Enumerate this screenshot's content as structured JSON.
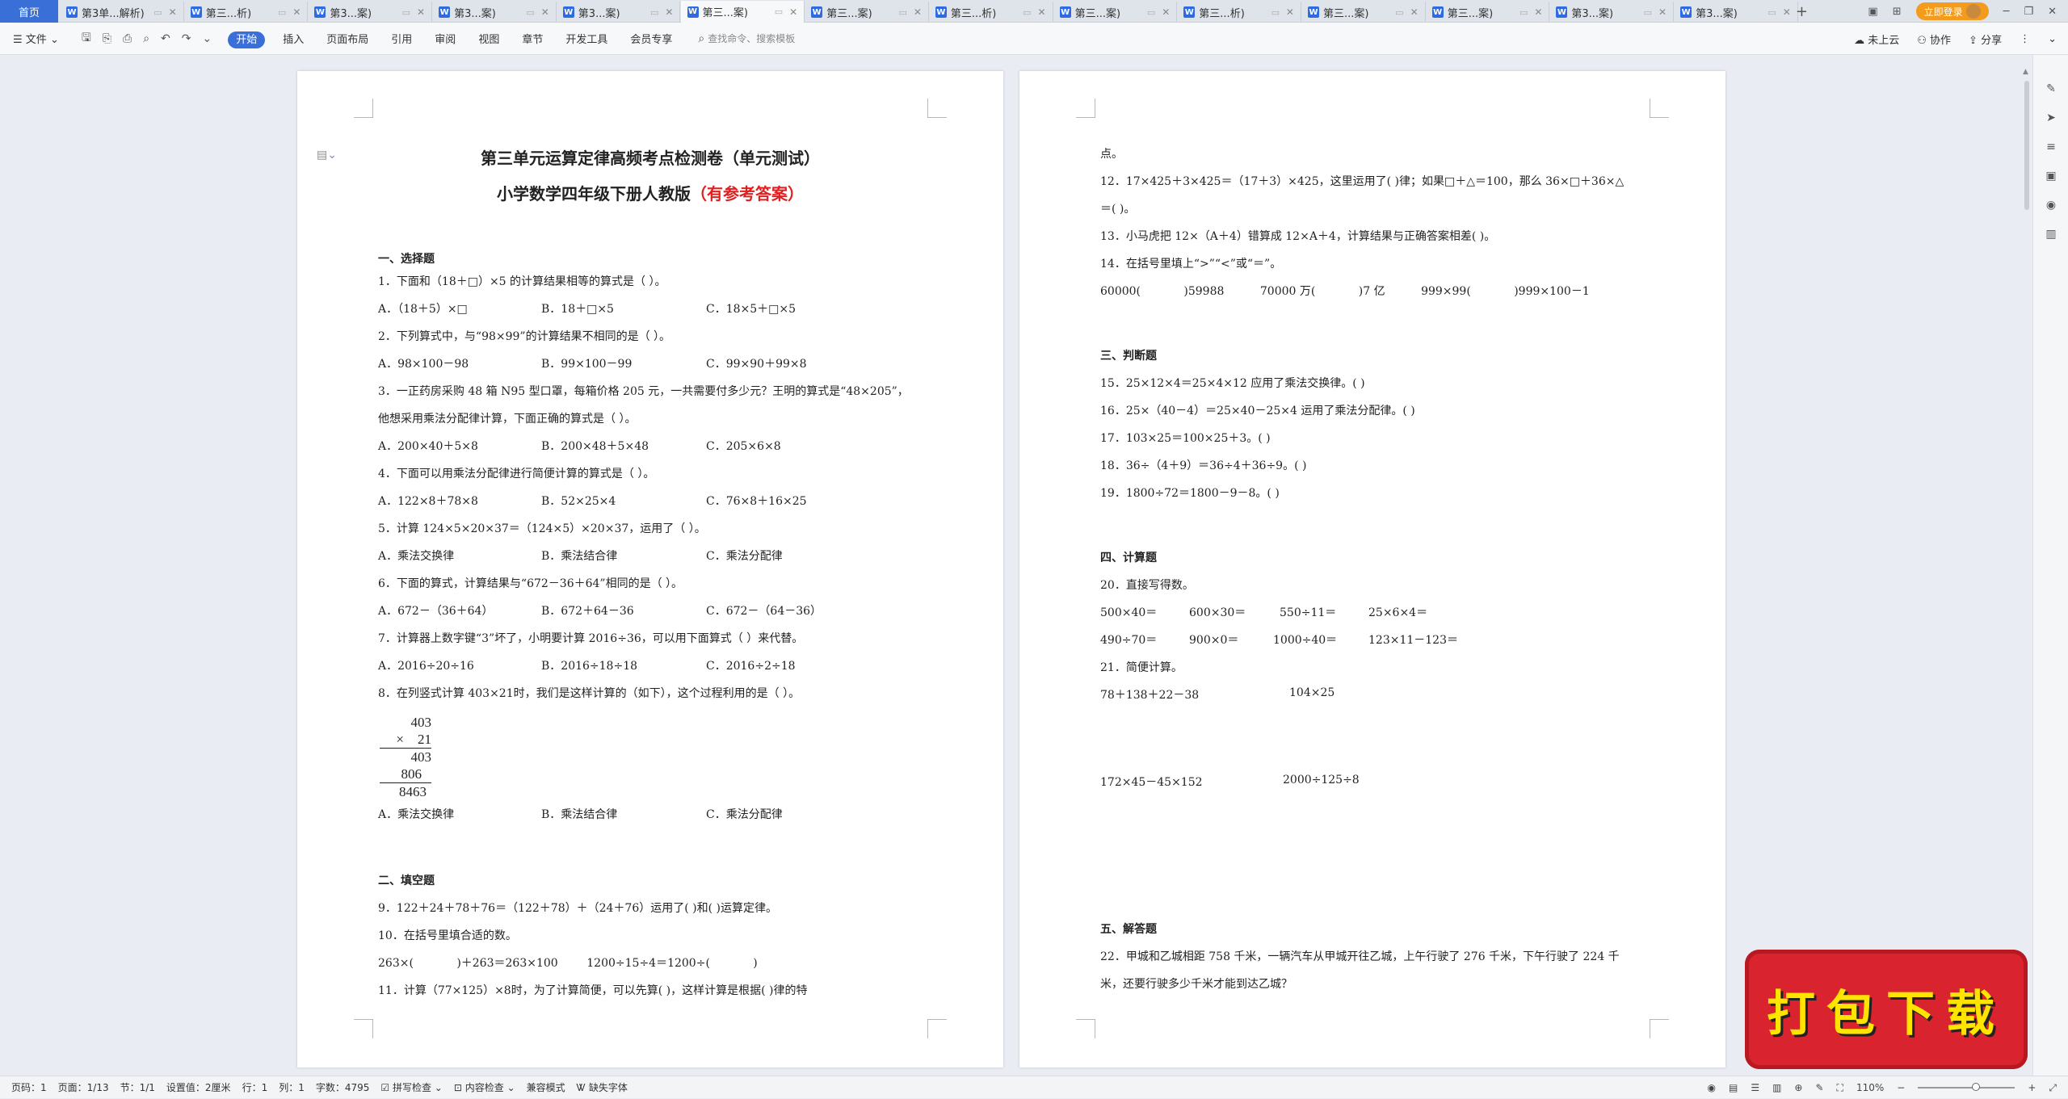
{
  "tabs": {
    "home": "首页",
    "items": [
      {
        "label": "第3单...解析)"
      },
      {
        "label": "第三...析)"
      },
      {
        "label": "第3...案)"
      },
      {
        "label": "第3...案)"
      },
      {
        "label": "第3...案)"
      },
      {
        "label": "第三...案)"
      },
      {
        "label": "第三...案)"
      },
      {
        "label": "第三...析)"
      },
      {
        "label": "第三...案)"
      },
      {
        "label": "第三...析)"
      },
      {
        "label": "第三...案)"
      },
      {
        "label": "第三...案)"
      },
      {
        "label": "第3...案)"
      },
      {
        "label": "第3...案)"
      }
    ],
    "new_tab": "+",
    "login": "立即登录"
  },
  "menu": {
    "file": "文件",
    "items": [
      "开始",
      "插入",
      "页面布局",
      "引用",
      "审阅",
      "视图",
      "章节",
      "开发工具",
      "会员专享"
    ],
    "search_placeholder": "查找命令、搜索模板",
    "right": [
      "未上云",
      "协作",
      "分享"
    ]
  },
  "doc": {
    "title": "第三单元运算定律高频考点检测卷（单元测试）",
    "subtitle_main": "小学数学四年级下册人教版",
    "subtitle_red": "（有参考答案）",
    "sec1": "一、选择题",
    "q1": "1．下面和（18＋□）×5 的计算结果相等的算式是（    ）。",
    "q1a": "A．（18＋5）×□",
    "q1b": "B．18＋□×5",
    "q1c": "C．18×5＋□×5",
    "q2": "2．下列算式中，与“98×99”的计算结果不相同的是（    ）。",
    "q2a": "A．98×100－98",
    "q2b": "B．99×100－99",
    "q2c": "C．99×90＋99×8",
    "q3": "3．一正药房采购 48 箱 N95 型口罩，每箱价格 205 元，一共需要付多少元？王明的算式是“48×205”，",
    "q3b": "他想采用乘法分配律计算，下面正确的算式是（    ）。",
    "q3oa": "A．200×40＋5×8",
    "q3ob": "B．200×48＋5×48",
    "q3oc": "C．205×6×8",
    "q4": "4．下面可以用乘法分配律进行简便计算的算式是（    ）。",
    "q4a": "A．122×8＋78×8",
    "q4b": "B．52×25×4",
    "q4c": "C．76×8＋16×25",
    "q5": "5．计算 124×5×20×37＝（124×5）×20×37，运用了（    ）。",
    "q5a": "A．乘法交换律",
    "q5b": "B．乘法结合律",
    "q5c": "C．乘法分配律",
    "q6": "6．下面的算式，计算结果与“672－36＋64”相同的是（    ）。",
    "q6a": "A．672－（36＋64）",
    "q6b": "B．672＋64－36",
    "q6c": "C．672－（64－36）",
    "q7": "7．计算器上数字键“3”坏了，小明要计算 2016÷36，可以用下面算式（    ）来代替。",
    "q7a": "A．2016÷20÷16",
    "q7b": "B．2016÷18÷18",
    "q7c": "C．2016÷2÷18",
    "q8": "8．在列竖式计算 403×21时，我们是这样计算的（如下），这个过程利用的是（    ）。",
    "calc": {
      "l1": "403",
      "l2": "×    21",
      "l3": "403",
      "l4": "806",
      "l5": "8463"
    },
    "q8a": "A．乘法交换律",
    "q8b": "B．乘法结合律",
    "q8c": "C．乘法分配律",
    "sec2": "二、填空题",
    "q9": "9．122＋24＋78＋76＝（122＋78）＋（24＋76）运用了(            )和(            )运算定律。",
    "q10": "10．在括号里填合适的数。",
    "q10a": "263×(            )＋263＝263×100        1200÷15÷4＝1200÷(            )",
    "q11": "11．计算（77×125）×8时，为了计算简便，可以先算(            )，这样计算是根据(            )律的特",
    "p2l1": "点。",
    "q12": "12．17×425＋3×425＝（17＋3）×425，这里运用了(            )律；如果□＋△＝100，那么 36×□＋36×△",
    "q12b": "＝(            )。",
    "q13": "13．小马虎把 12×（A＋4）错算成 12×A＋4，计算结果与正确答案相差(            )。",
    "q14": "14．在括号里填上“>”“<”或“＝”。",
    "q14a": "60000(            )59988          70000 万(            )7 亿          999×99(            )999×100－1",
    "sec3": "三、判断题",
    "q15": "15．25×12×4＝25×4×12 应用了乘法交换律。(            )",
    "q16": "16．25×（40－4）＝25×40－25×4 运用了乘法分配律。(            )",
    "q17": "17．103×25＝100×25＋3。(            )",
    "q18": "18．36÷（4＋9）＝36÷4＋36÷9。(            )",
    "q19": "19．1800÷72＝1800－9－8。(            )",
    "sec4": "四、计算题",
    "q20": "20．直接写得数。",
    "q20r1": [
      "500×40＝",
      "600×30＝",
      "550÷11＝",
      "25×6×4＝"
    ],
    "q20r2": [
      "490÷70＝",
      "900×0＝",
      "1000÷40＝",
      "123×11－123＝"
    ],
    "q21": "21．简便计算。",
    "q21a": "78＋138＋22－38",
    "q21b": "104×25",
    "q21c": "172×45－45×152",
    "q21d": "2000÷125÷8",
    "sec5": "五、解答题",
    "q22": "22．甲城和乙城相距 758 千米，一辆汽车从甲城开往乙城，上午行驶了 276 千米，下午行驶了 224 千",
    "q22b": "米，还要行驶多少千米才能到达乙城？"
  },
  "status": {
    "pagenum": "页码：1",
    "pages": "页面：1/13",
    "section": "节：1/1",
    "setting": "设置值：2厘米",
    "row": "行：1",
    "col": "列：1",
    "words": "字数：4795",
    "spell": "拼写检查",
    "content": "内容检查",
    "compat": "兼容模式",
    "missing_font": "缺失字体",
    "zoom": "110%",
    "zoom_value": 0.6
  },
  "badge": {
    "text": "打包下载"
  }
}
